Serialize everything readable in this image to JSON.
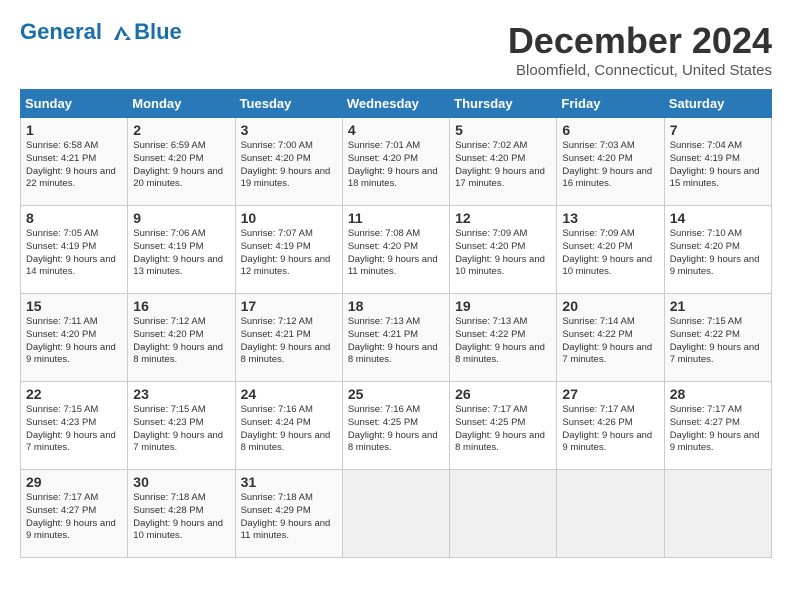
{
  "header": {
    "logo_line1": "General",
    "logo_line2": "Blue",
    "month": "December 2024",
    "location": "Bloomfield, Connecticut, United States"
  },
  "days_of_week": [
    "Sunday",
    "Monday",
    "Tuesday",
    "Wednesday",
    "Thursday",
    "Friday",
    "Saturday"
  ],
  "weeks": [
    [
      {
        "day": "1",
        "sunrise": "6:58 AM",
        "sunset": "4:21 PM",
        "daylight": "9 hours and 22 minutes."
      },
      {
        "day": "2",
        "sunrise": "6:59 AM",
        "sunset": "4:20 PM",
        "daylight": "9 hours and 20 minutes."
      },
      {
        "day": "3",
        "sunrise": "7:00 AM",
        "sunset": "4:20 PM",
        "daylight": "9 hours and 19 minutes."
      },
      {
        "day": "4",
        "sunrise": "7:01 AM",
        "sunset": "4:20 PM",
        "daylight": "9 hours and 18 minutes."
      },
      {
        "day": "5",
        "sunrise": "7:02 AM",
        "sunset": "4:20 PM",
        "daylight": "9 hours and 17 minutes."
      },
      {
        "day": "6",
        "sunrise": "7:03 AM",
        "sunset": "4:20 PM",
        "daylight": "9 hours and 16 minutes."
      },
      {
        "day": "7",
        "sunrise": "7:04 AM",
        "sunset": "4:19 PM",
        "daylight": "9 hours and 15 minutes."
      }
    ],
    [
      {
        "day": "8",
        "sunrise": "7:05 AM",
        "sunset": "4:19 PM",
        "daylight": "9 hours and 14 minutes."
      },
      {
        "day": "9",
        "sunrise": "7:06 AM",
        "sunset": "4:19 PM",
        "daylight": "9 hours and 13 minutes."
      },
      {
        "day": "10",
        "sunrise": "7:07 AM",
        "sunset": "4:19 PM",
        "daylight": "9 hours and 12 minutes."
      },
      {
        "day": "11",
        "sunrise": "7:08 AM",
        "sunset": "4:20 PM",
        "daylight": "9 hours and 11 minutes."
      },
      {
        "day": "12",
        "sunrise": "7:09 AM",
        "sunset": "4:20 PM",
        "daylight": "9 hours and 10 minutes."
      },
      {
        "day": "13",
        "sunrise": "7:09 AM",
        "sunset": "4:20 PM",
        "daylight": "9 hours and 10 minutes."
      },
      {
        "day": "14",
        "sunrise": "7:10 AM",
        "sunset": "4:20 PM",
        "daylight": "9 hours and 9 minutes."
      }
    ],
    [
      {
        "day": "15",
        "sunrise": "7:11 AM",
        "sunset": "4:20 PM",
        "daylight": "9 hours and 9 minutes."
      },
      {
        "day": "16",
        "sunrise": "7:12 AM",
        "sunset": "4:20 PM",
        "daylight": "9 hours and 8 minutes."
      },
      {
        "day": "17",
        "sunrise": "7:12 AM",
        "sunset": "4:21 PM",
        "daylight": "9 hours and 8 minutes."
      },
      {
        "day": "18",
        "sunrise": "7:13 AM",
        "sunset": "4:21 PM",
        "daylight": "9 hours and 8 minutes."
      },
      {
        "day": "19",
        "sunrise": "7:13 AM",
        "sunset": "4:22 PM",
        "daylight": "9 hours and 8 minutes."
      },
      {
        "day": "20",
        "sunrise": "7:14 AM",
        "sunset": "4:22 PM",
        "daylight": "9 hours and 7 minutes."
      },
      {
        "day": "21",
        "sunrise": "7:15 AM",
        "sunset": "4:22 PM",
        "daylight": "9 hours and 7 minutes."
      }
    ],
    [
      {
        "day": "22",
        "sunrise": "7:15 AM",
        "sunset": "4:23 PM",
        "daylight": "9 hours and 7 minutes."
      },
      {
        "day": "23",
        "sunrise": "7:15 AM",
        "sunset": "4:23 PM",
        "daylight": "9 hours and 7 minutes."
      },
      {
        "day": "24",
        "sunrise": "7:16 AM",
        "sunset": "4:24 PM",
        "daylight": "9 hours and 8 minutes."
      },
      {
        "day": "25",
        "sunrise": "7:16 AM",
        "sunset": "4:25 PM",
        "daylight": "9 hours and 8 minutes."
      },
      {
        "day": "26",
        "sunrise": "7:17 AM",
        "sunset": "4:25 PM",
        "daylight": "9 hours and 8 minutes."
      },
      {
        "day": "27",
        "sunrise": "7:17 AM",
        "sunset": "4:26 PM",
        "daylight": "9 hours and 9 minutes."
      },
      {
        "day": "28",
        "sunrise": "7:17 AM",
        "sunset": "4:27 PM",
        "daylight": "9 hours and 9 minutes."
      }
    ],
    [
      {
        "day": "29",
        "sunrise": "7:17 AM",
        "sunset": "4:27 PM",
        "daylight": "9 hours and 9 minutes."
      },
      {
        "day": "30",
        "sunrise": "7:18 AM",
        "sunset": "4:28 PM",
        "daylight": "9 hours and 10 minutes."
      },
      {
        "day": "31",
        "sunrise": "7:18 AM",
        "sunset": "4:29 PM",
        "daylight": "9 hours and 11 minutes."
      },
      null,
      null,
      null,
      null
    ]
  ]
}
